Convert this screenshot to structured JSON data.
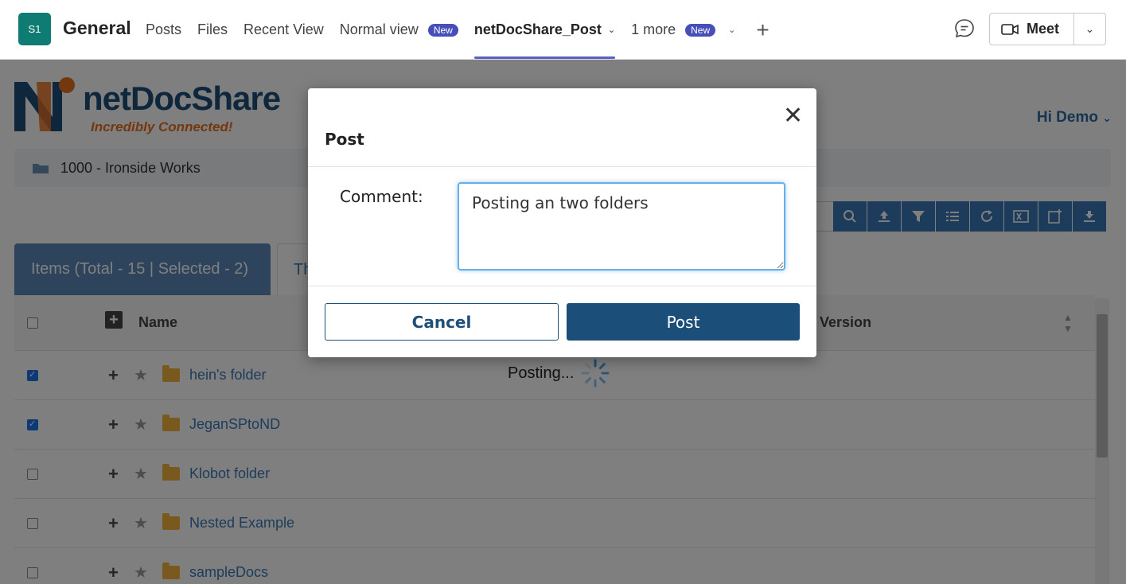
{
  "teams_header": {
    "team_initials": "S1",
    "channel_name": "General",
    "tabs": [
      {
        "label": "Posts"
      },
      {
        "label": "Files"
      },
      {
        "label": "Recent View"
      },
      {
        "label": "Normal view",
        "badge": "New"
      },
      {
        "label": "netDocShare_Post",
        "active": true
      },
      {
        "label": "1 more",
        "badge": "New"
      }
    ],
    "meet_label": "Meet"
  },
  "app": {
    "logo_text": "netDocShare",
    "logo_tagline": "Incredibly Connected!",
    "greeting": "Hi Demo",
    "breadcrumb": "1000 - Ironside Works",
    "items_tab_label": "Items (Total - 15 | Selected - 2)",
    "second_tab_label": "Th",
    "columns": {
      "name": "Name",
      "version": "Version"
    },
    "rows": [
      {
        "name": "hein's folder",
        "checked": true
      },
      {
        "name": "JeganSPtoND",
        "checked": true
      },
      {
        "name": "Klobot folder",
        "checked": false
      },
      {
        "name": "Nested Example",
        "checked": false
      },
      {
        "name": "sampleDocs",
        "checked": false
      }
    ],
    "posting_status": "Posting..."
  },
  "modal": {
    "title": "Post",
    "close_symbol": "✕",
    "comment_label": "Comment:",
    "comment_value": "Posting an two folders",
    "cancel_label": "Cancel",
    "post_label": "Post"
  },
  "colors": {
    "teams_accent": "#5b5fc7",
    "app_primary": "#1c4e7a",
    "toolbar_blue": "#3b79b6",
    "logo_orange": "#e8711e"
  }
}
